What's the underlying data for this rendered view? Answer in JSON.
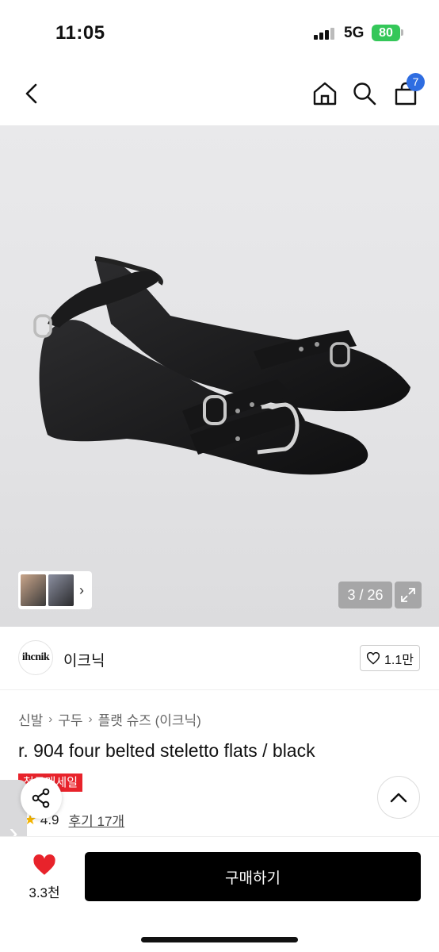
{
  "status_bar": {
    "time": "11:05",
    "network": "5G",
    "battery": "80"
  },
  "nav": {
    "cart_count": "7",
    "icons": [
      "back-icon",
      "home-icon",
      "search-icon",
      "cart-icon"
    ]
  },
  "gallery": {
    "counter": "3 / 26",
    "thumb_chevron": "›"
  },
  "brand": {
    "logo_text": "ihcnik",
    "name": "이크닉",
    "like_count": "1.1만"
  },
  "breadcrumb": {
    "items": [
      "신발",
      "구두",
      "플랫 슈즈 (이크닉)"
    ],
    "separator": "›"
  },
  "product": {
    "title": "r. 904 four belted steletto flats / black",
    "badge": "첫구매세일",
    "rating": "4.9",
    "reviews": "후기 17개"
  },
  "side_tab": {
    "glyph": "›"
  },
  "bottom": {
    "wish_count": "3.3천",
    "buy_label": "구매하기"
  },
  "colors": {
    "accent": "#2f6de1",
    "sale": "#e8232b",
    "heart": "#e8232b",
    "battery": "#34c759"
  }
}
